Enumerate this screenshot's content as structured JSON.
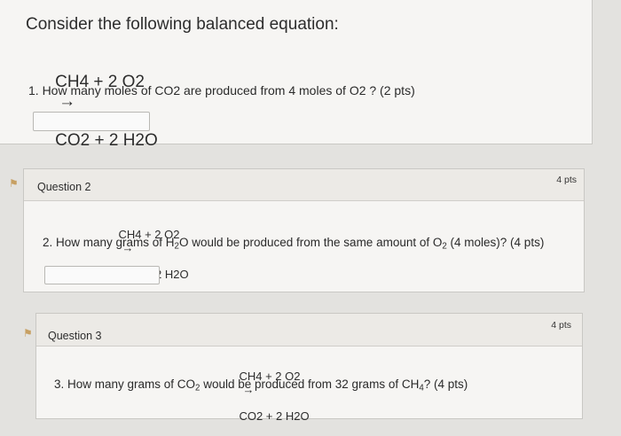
{
  "q1": {
    "intro": "Consider the following balanced equation:",
    "equation_left": "CH4 + 2 O2",
    "arrow": "→",
    "equation_right": "CO2 + 2 H2O",
    "prompt": "1. How many moles of CO2  are produced from 4 moles of O2 ? (2 pts)",
    "answer_value": ""
  },
  "q2": {
    "title": "Question 2",
    "points": "4 pts",
    "equation_left": "CH4 + 2 O2",
    "arrow": "→",
    "equation_right": "CO2 + 2 H2O",
    "prompt_a": "2. How many grams of H",
    "prompt_sub1": "2",
    "prompt_b": "O would be produced from the same amount of O",
    "prompt_sub2": "2",
    "prompt_c": " (4 moles)? (4 pts)",
    "answer_value": ""
  },
  "q3": {
    "title": "Question 3",
    "points": "4 pts",
    "equation_left": "CH4 + 2 O2",
    "arrow": "→",
    "equation_right": "CO2 + 2 H2O",
    "prompt_a": "3. How many grams of CO",
    "prompt_sub1": "2",
    "prompt_b": " would be produced from 32 grams of CH",
    "prompt_sub2": "4",
    "prompt_c": "? (4 pts)"
  },
  "icons": {
    "flag": "flag-icon"
  },
  "colors": {
    "flag": "#c7a063",
    "card_bg": "#f6f5f3",
    "header_bg": "#eceae6"
  }
}
